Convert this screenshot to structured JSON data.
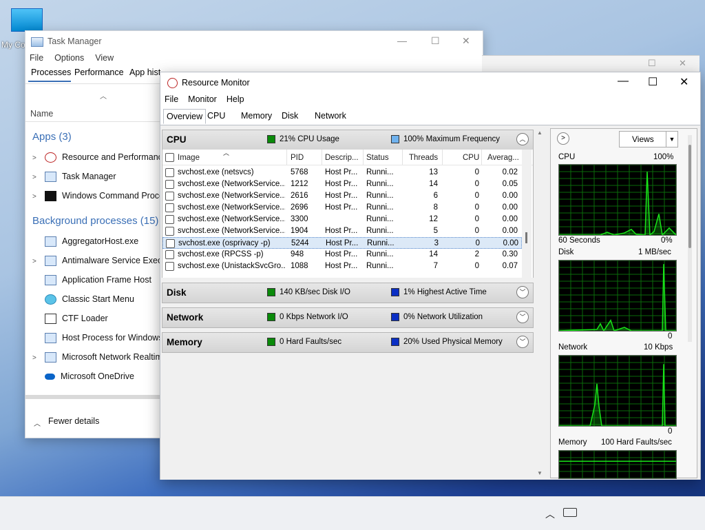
{
  "desktop": {
    "icon_label": "My Co"
  },
  "task_manager": {
    "title": "Task Manager",
    "menu": [
      "File",
      "Options",
      "View"
    ],
    "tabs": [
      "Processes",
      "Performance",
      "App hist"
    ],
    "column_name": "Name",
    "apps_header": "Apps (3)",
    "apps": [
      "Resource and Performance",
      "Task Manager",
      "Windows Command Proces"
    ],
    "bg_header": "Background processes (15)",
    "bg_items": [
      "AggregatorHost.exe",
      "Antimalware Service Execut",
      "Application Frame Host",
      "Classic Start Menu",
      "CTF Loader",
      "Host Process for Windows T",
      "Microsoft Network Realtime",
      "Microsoft OneDrive"
    ],
    "fewer_details": "Fewer details"
  },
  "resource_monitor": {
    "title": "Resource Monitor",
    "menu": [
      "File",
      "Monitor",
      "Help"
    ],
    "tabs": [
      "Overview",
      "CPU",
      "Memory",
      "Disk",
      "Network"
    ],
    "cpu": {
      "name": "CPU",
      "stat1": "21% CPU Usage",
      "stat2": "100% Maximum Frequency"
    },
    "disk": {
      "name": "Disk",
      "stat1": "140 KB/sec Disk I/O",
      "stat2": "1% Highest Active Time"
    },
    "network": {
      "name": "Network",
      "stat1": "0 Kbps Network I/O",
      "stat2": "0% Network Utilization"
    },
    "memory": {
      "name": "Memory",
      "stat1": "0 Hard Faults/sec",
      "stat2": "20% Used Physical Memory"
    },
    "columns": [
      "Image",
      "PID",
      "Descrip...",
      "Status",
      "Threads",
      "CPU",
      "Averag..."
    ],
    "rows": [
      [
        "svchost.exe (netsvcs)",
        "5768",
        "Host Pr...",
        "Runni...",
        "13",
        "0",
        "0.02"
      ],
      [
        "svchost.exe (NetworkService...",
        "1212",
        "Host Pr...",
        "Runni...",
        "14",
        "0",
        "0.05"
      ],
      [
        "svchost.exe (NetworkService...",
        "2616",
        "Host Pr...",
        "Runni...",
        "6",
        "0",
        "0.00"
      ],
      [
        "svchost.exe (NetworkService...",
        "2696",
        "Host Pr...",
        "Runni...",
        "8",
        "0",
        "0.00"
      ],
      [
        "svchost.exe (NetworkService...",
        "3300",
        "",
        "Runni...",
        "12",
        "0",
        "0.00"
      ],
      [
        "svchost.exe (NetworkService...",
        "1904",
        "Host Pr...",
        "Runni...",
        "5",
        "0",
        "0.00"
      ],
      [
        "svchost.exe (osprivacy -p)",
        "5244",
        "Host Pr...",
        "Runni...",
        "3",
        "0",
        "0.00"
      ],
      [
        "svchost.exe (RPCSS -p)",
        "948",
        "Host Pr...",
        "Runni...",
        "14",
        "2",
        "0.30"
      ],
      [
        "svchost.exe (UnistackSvcGro...",
        "1088",
        "Host Pr...",
        "Runni...",
        "7",
        "0",
        "0.07"
      ]
    ],
    "selected_row": 6,
    "views_label": "Views",
    "graphs": {
      "cpu": {
        "title": "CPU",
        "max": "100%",
        "footer_left": "60 Seconds",
        "footer_right": "0%"
      },
      "disk": {
        "title": "Disk",
        "max": "1 MB/sec",
        "footer_right": "0"
      },
      "network": {
        "title": "Network",
        "max": "10 Kbps",
        "footer_right": "0"
      },
      "memory": {
        "title": "Memory",
        "max": "100 Hard Faults/sec"
      }
    }
  },
  "colors": {
    "graph_line": "#19e619",
    "grid": "#0a6a0a",
    "accent_blue": "#3a6fb6"
  }
}
